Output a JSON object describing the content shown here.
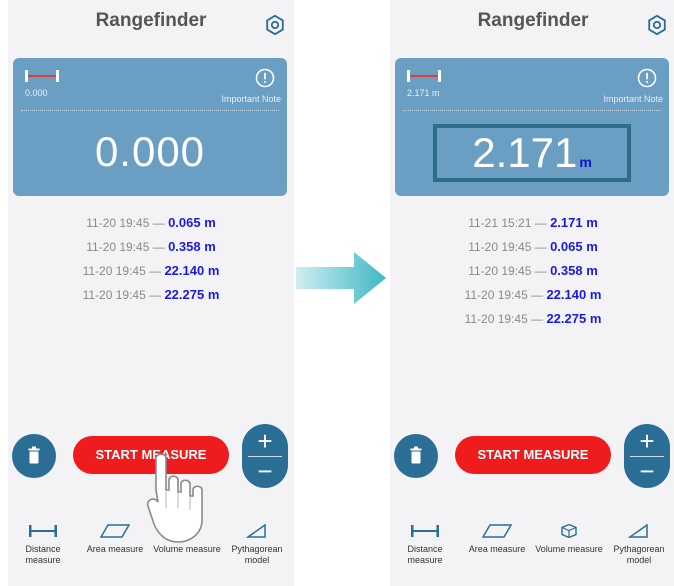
{
  "left_screen": {
    "title": "Rangefinder",
    "mini_value": "0.000",
    "note_label": "Important Note",
    "reading": "0.000",
    "history": [
      {
        "time": "11-20 19:45",
        "sep": "—",
        "value": "0.065 m"
      },
      {
        "time": "11-20 19:45",
        "sep": "—",
        "value": "0.358 m"
      },
      {
        "time": "11-20 19:45",
        "sep": "—",
        "value": "22.140 m"
      },
      {
        "time": "11-20 19:45",
        "sep": "—",
        "value": "22.275 m"
      }
    ],
    "start_label": "START MEASURE",
    "zoom_plus": "+",
    "zoom_minus": "−",
    "tabs": [
      {
        "label": "Distance measure",
        "icon": "distance-icon"
      },
      {
        "label": "Area measure",
        "icon": "area-icon"
      },
      {
        "label": "Volume measure",
        "icon": "volume-icon"
      },
      {
        "label": "Pythagorean model",
        "icon": "pythagorean-icon"
      }
    ]
  },
  "right_screen": {
    "title": "Rangefinder",
    "mini_value": "2.171 m",
    "note_label": "Important Note",
    "reading": "2.171",
    "reading_unit": "m",
    "history": [
      {
        "time": "11-21 15:21",
        "sep": "—",
        "value": "2.171 m"
      },
      {
        "time": "11-20 19:45",
        "sep": "—",
        "value": "0.065 m"
      },
      {
        "time": "11-20 19:45",
        "sep": "—",
        "value": "0.358 m"
      },
      {
        "time": "11-20 19:45",
        "sep": "—",
        "value": "22.140 m"
      },
      {
        "time": "11-20 19:45",
        "sep": "—",
        "value": "22.275 m"
      }
    ],
    "start_label": "START MEASURE",
    "zoom_plus": "+",
    "zoom_minus": "−",
    "tabs": [
      {
        "label": "Distance measure",
        "icon": "distance-icon"
      },
      {
        "label": "Area measure",
        "icon": "area-icon"
      },
      {
        "label": "Volume measure",
        "icon": "volume-icon"
      },
      {
        "label": "Pythagorean model",
        "icon": "pythagorean-icon"
      }
    ]
  },
  "colors": {
    "card": "#6a9ec3",
    "accent_blue": "#2a6e96",
    "start_red": "#ee1c1c",
    "value_blue": "#1a1ae6",
    "arrow_teal": "#3fb8c6"
  },
  "overlays": {
    "transition_arrow": "right-arrow-icon",
    "tap_gesture": "hand-tap-icon"
  }
}
